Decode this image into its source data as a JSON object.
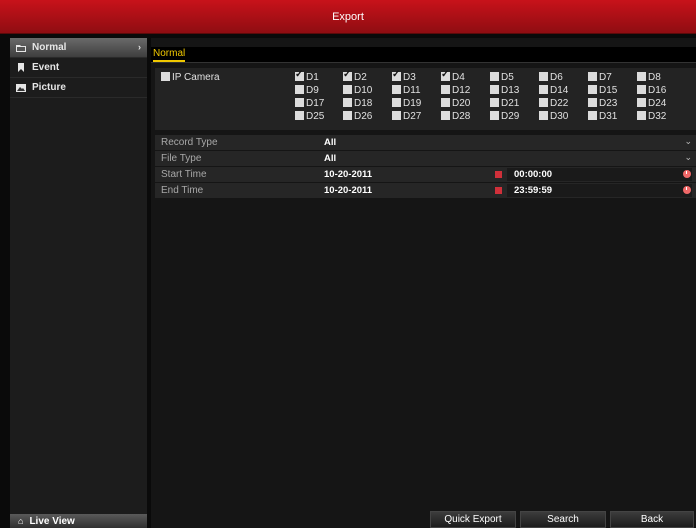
{
  "title": "Export",
  "sidebar": {
    "items": [
      {
        "label": "Normal",
        "icon": "folder-icon",
        "active": true
      },
      {
        "label": "Event",
        "icon": "event-icon",
        "active": false
      },
      {
        "label": "Picture",
        "icon": "picture-icon",
        "active": false
      }
    ],
    "live_view": "Live View"
  },
  "tabs": [
    {
      "label": "Normal"
    }
  ],
  "camera": {
    "label": "IP Camera",
    "checked": false,
    "channels": [
      {
        "label": "D1",
        "checked": true
      },
      {
        "label": "D2",
        "checked": true
      },
      {
        "label": "D3",
        "checked": true
      },
      {
        "label": "D4",
        "checked": true
      },
      {
        "label": "D5",
        "checked": false
      },
      {
        "label": "D6",
        "checked": false
      },
      {
        "label": "D7",
        "checked": false
      },
      {
        "label": "D8",
        "checked": false
      },
      {
        "label": "D9",
        "checked": false
      },
      {
        "label": "D10",
        "checked": false
      },
      {
        "label": "D11",
        "checked": false
      },
      {
        "label": "D12",
        "checked": false
      },
      {
        "label": "D13",
        "checked": false
      },
      {
        "label": "D14",
        "checked": false
      },
      {
        "label": "D15",
        "checked": false
      },
      {
        "label": "D16",
        "checked": false
      },
      {
        "label": "D17",
        "checked": false
      },
      {
        "label": "D18",
        "checked": false
      },
      {
        "label": "D19",
        "checked": false
      },
      {
        "label": "D20",
        "checked": false
      },
      {
        "label": "D21",
        "checked": false
      },
      {
        "label": "D22",
        "checked": false
      },
      {
        "label": "D23",
        "checked": false
      },
      {
        "label": "D24",
        "checked": false
      },
      {
        "label": "D25",
        "checked": false
      },
      {
        "label": "D26",
        "checked": false
      },
      {
        "label": "D27",
        "checked": false
      },
      {
        "label": "D28",
        "checked": false
      },
      {
        "label": "D29",
        "checked": false
      },
      {
        "label": "D30",
        "checked": false
      },
      {
        "label": "D31",
        "checked": false
      },
      {
        "label": "D32",
        "checked": false
      }
    ]
  },
  "form": {
    "record_type": {
      "label": "Record Type",
      "value": "All"
    },
    "file_type": {
      "label": "File Type",
      "value": "All"
    },
    "start_time": {
      "label": "Start Time",
      "date": "10-20-2011",
      "time": "00:00:00"
    },
    "end_time": {
      "label": "End Time",
      "date": "10-20-2011",
      "time": "23:59:59"
    }
  },
  "buttons": {
    "quick_export": "Quick Export",
    "search": "Search",
    "back": "Back"
  },
  "colors": {
    "title_red": "#c8121a",
    "tab_yellow": "#f0c800",
    "calendar_icon": "#d0303a",
    "clock_icon": "#f06868"
  }
}
